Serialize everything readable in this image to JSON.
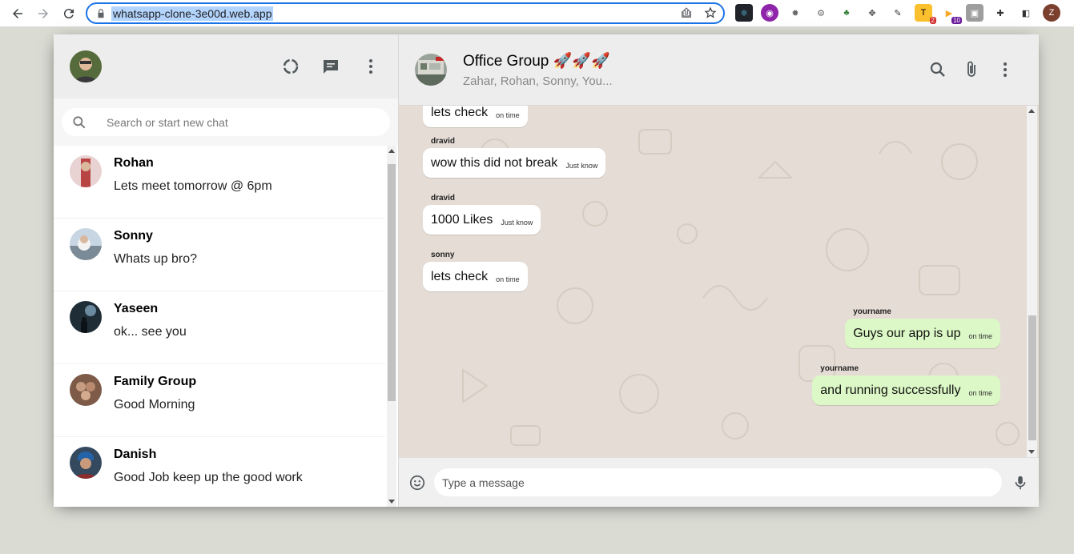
{
  "browser": {
    "url": "whatsapp-clone-3e00d.web.app",
    "profile_initial": "Z",
    "ext_badges": [
      "2",
      "10"
    ]
  },
  "sidebar": {
    "search_placeholder": "Search or start new chat",
    "chats": [
      {
        "name": "Rohan",
        "last_message": "Lets meet tomorrow @ 6pm",
        "avatar_color": "#c9a2a2"
      },
      {
        "name": "Sonny",
        "last_message": "Whats up bro?",
        "avatar_color": "#9fb3c8"
      },
      {
        "name": "Yaseen",
        "last_message": "ok... see you",
        "avatar_color": "#2f3e46"
      },
      {
        "name": "Family Group",
        "last_message": "Good Morning",
        "avatar_color": "#8a6d5a"
      },
      {
        "name": "Danish",
        "last_message": "Good Job keep up the good work",
        "avatar_color": "#3b4a5a"
      }
    ]
  },
  "chat": {
    "group_name": "Office Group 🚀🚀🚀",
    "members": "Zahar, Rohan, Sonny, You...",
    "input_placeholder": "Type a message",
    "messages": [
      {
        "sender": "",
        "text": "lets check",
        "time": "on time",
        "mine": false
      },
      {
        "sender": "dravid",
        "text": "wow this did not break",
        "time": "Just know",
        "mine": false
      },
      {
        "sender": "dravid",
        "text": "1000 Likes",
        "time": "Just know",
        "mine": false
      },
      {
        "sender": "sonny",
        "text": "lets check",
        "time": "on time",
        "mine": false
      },
      {
        "sender": "yourname",
        "text": "Guys our app is up",
        "time": "on time",
        "mine": true
      },
      {
        "sender": "yourname",
        "text": "and running successfully",
        "time": "on time",
        "mine": true
      }
    ]
  },
  "colors": {
    "sent_bubble": "#dcf8c6",
    "received_bubble": "#ffffff",
    "chat_bg": "#e5ddd5",
    "focus_blue": "#1a73e8"
  }
}
